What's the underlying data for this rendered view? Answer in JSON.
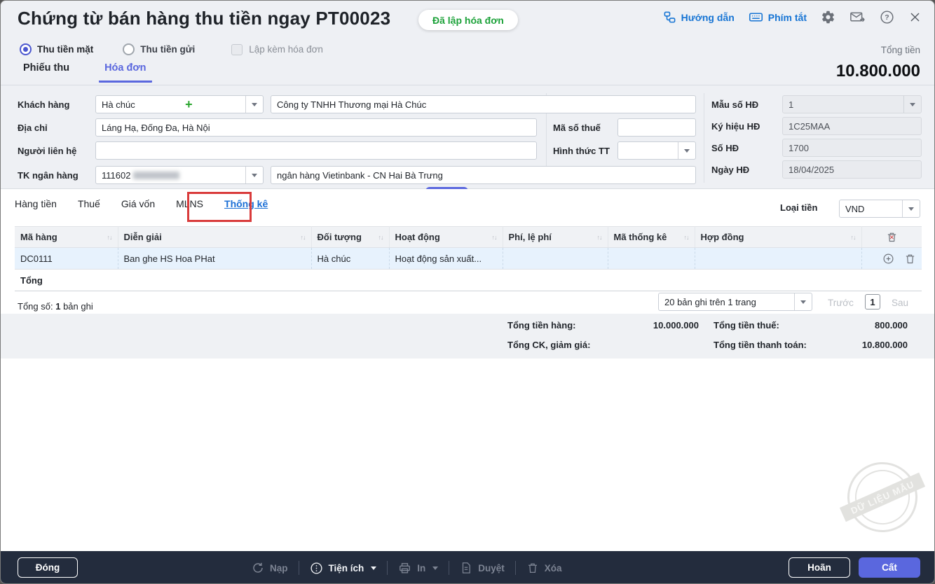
{
  "colors": {
    "accent_indigo": "#5a67de",
    "link_blue": "#1674d4",
    "badge_green": "#1da23a",
    "annotation_red": "#d93b3b",
    "footer_bg": "#232c3d",
    "selected_row_bg": "#e7f2fd"
  },
  "header": {
    "title": "Chứng từ bán hàng thu tiền ngay PT00023",
    "status_badge": "Đã lập hóa đơn",
    "guide_link": "Hướng dẫn",
    "shortcut_link": "Phím tắt",
    "total_label": "Tổng tiền",
    "total_value": "10.800.000"
  },
  "payment_options": {
    "cash_radio": "Thu tiền mặt",
    "deposit_radio": "Thu tiền gửi",
    "invoice_checkbox": "Lập kèm hóa đơn"
  },
  "doc_tabs": [
    {
      "label": "Phiếu thu",
      "active": false
    },
    {
      "label": "Hóa đơn",
      "active": true
    }
  ],
  "form": {
    "customer_label": "Khách hàng",
    "customer_code": "Hà chúc",
    "customer_name": "Công ty TNHH Thương mại Hà Chúc",
    "address_label": "Địa chỉ",
    "address_value": "Láng Hạ, Đống Đa, Hà Nội",
    "tax_code_label": "Mã số thuế",
    "tax_code_value": "",
    "contact_label": "Người liên hệ",
    "contact_value": "",
    "payment_method_label": "Hình thức TT",
    "payment_method_value": "",
    "bank_account_label": "TK ngân hàng",
    "bank_account_value": "111602",
    "bank_name_value": "ngân hàng Vietinbank  -  CN Hai Bà Trưng"
  },
  "invoice_info": {
    "template_label": "Mẫu số HĐ",
    "template_value": "1",
    "symbol_label": "Ký hiệu HĐ",
    "symbol_value": "1C25MAA",
    "number_label": "Số HĐ",
    "number_value": "1700",
    "date_label": "Ngày HĐ",
    "date_value": "18/04/2025"
  },
  "detail_tabs": [
    {
      "label": "Hàng tiền",
      "active": false
    },
    {
      "label": "Thuế",
      "active": false
    },
    {
      "label": "Giá vốn",
      "active": false
    },
    {
      "label": "MLNS",
      "active": false
    },
    {
      "label": "Thống kê",
      "active": true,
      "annotated": true
    }
  ],
  "currency": {
    "label": "Loại tiền",
    "value": "VND"
  },
  "table": {
    "columns": [
      "Mã hàng",
      "Diễn giải",
      "Đối tượng",
      "Hoạt động",
      "Phí, lệ phí",
      "Mã thống kê",
      "Hợp đồng"
    ],
    "rows": [
      [
        "DC0111",
        "Ban ghe HS Hoa PHat",
        "Hà chúc",
        "Hoạt động sản xuất...",
        "",
        "",
        ""
      ]
    ],
    "footer_label": "Tổng"
  },
  "pagination": {
    "total_prefix": "Tổng số:",
    "total_count": "1",
    "total_suffix": "bản ghi",
    "page_size": "20 bản ghi trên 1 trang",
    "prev_label": "Trước",
    "current_page": "1",
    "next_label": "Sau"
  },
  "totals": {
    "goods_label": "Tổng tiền hàng:",
    "goods_value": "10.000.000",
    "tax_label": "Tổng tiền thuế:",
    "tax_value": "800.000",
    "discount_label": "Tổng CK, giảm giá:",
    "discount_value": "",
    "payment_label": "Tổng tiền thanh toán:",
    "payment_value": "10.800.000"
  },
  "watermark": {
    "text": "DỮ LIỆU MẪU"
  },
  "footer": {
    "close": "Đóng",
    "reload": "Nạp",
    "utilities": "Tiện ích",
    "print": "In",
    "approve": "Duyệt",
    "delete": "Xóa",
    "postpone": "Hoãn",
    "save": "Cất"
  }
}
